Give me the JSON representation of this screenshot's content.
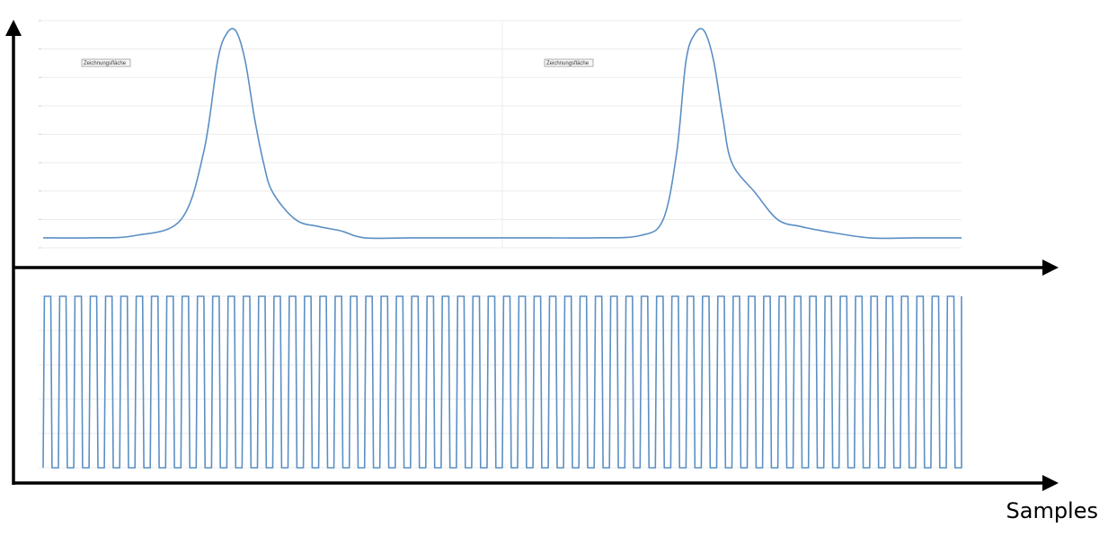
{
  "figure": {
    "x_axis_label": "Samples",
    "tooltip_label": "Zeichnungsfläche",
    "colors": {
      "trace": "#5b8fc4",
      "grid": "#ececec",
      "axis": "#000000"
    }
  },
  "chart_data": [
    {
      "type": "line",
      "title": "",
      "xlabel": "",
      "ylabel": "",
      "grid": true,
      "legend": "none",
      "description_values": {
        "periods": 2,
        "shape": "single narrow peak per period with a small shoulder on the falling edge",
        "baseline": 0.02,
        "peak": 0.93,
        "shoulder": 0.06
      },
      "series": [
        {
          "x": [
            0,
            10,
            20,
            30,
            35,
            38,
            40,
            42,
            44,
            46,
            48,
            50,
            55,
            60,
            65,
            70,
            80,
            90,
            100,
            110,
            120,
            130,
            135,
            138,
            140,
            142,
            144,
            146,
            148,
            150,
            155,
            160,
            165,
            170,
            180,
            190,
            200
          ],
          "values": [
            0.02,
            0.02,
            0.03,
            0.1,
            0.4,
            0.8,
            0.92,
            0.93,
            0.8,
            0.55,
            0.35,
            0.22,
            0.1,
            0.07,
            0.05,
            0.02,
            0.02,
            0.02,
            0.02,
            0.02,
            0.02,
            0.03,
            0.1,
            0.4,
            0.8,
            0.92,
            0.93,
            0.8,
            0.55,
            0.35,
            0.22,
            0.1,
            0.07,
            0.05,
            0.02,
            0.02,
            0.02
          ]
        }
      ]
    },
    {
      "type": "line",
      "title": "",
      "xlabel": "Samples",
      "ylabel": "",
      "grid": true,
      "legend": "none",
      "series": [
        {
          "name": "",
          "square_wave": {
            "cycles": 60,
            "low": 0,
            "high": 1,
            "duty": 0.5
          }
        }
      ]
    }
  ]
}
